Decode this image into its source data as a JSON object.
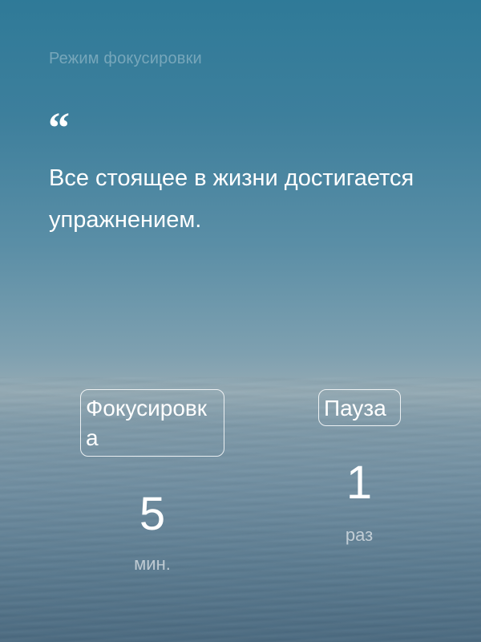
{
  "header": {
    "title": "Режим фокусировки"
  },
  "quote": {
    "mark": "“",
    "text": "Все стоящее в жизни достигается упражнением."
  },
  "modes": {
    "focus": {
      "label": "Фокусировка",
      "value": "5",
      "unit": "мин."
    },
    "pause": {
      "label": "Пауза",
      "value": "1",
      "unit": "раз"
    }
  },
  "colors": {
    "background_top": "#2f7a98",
    "background_bottom": "#4b6a80",
    "text": "#ffffff"
  }
}
